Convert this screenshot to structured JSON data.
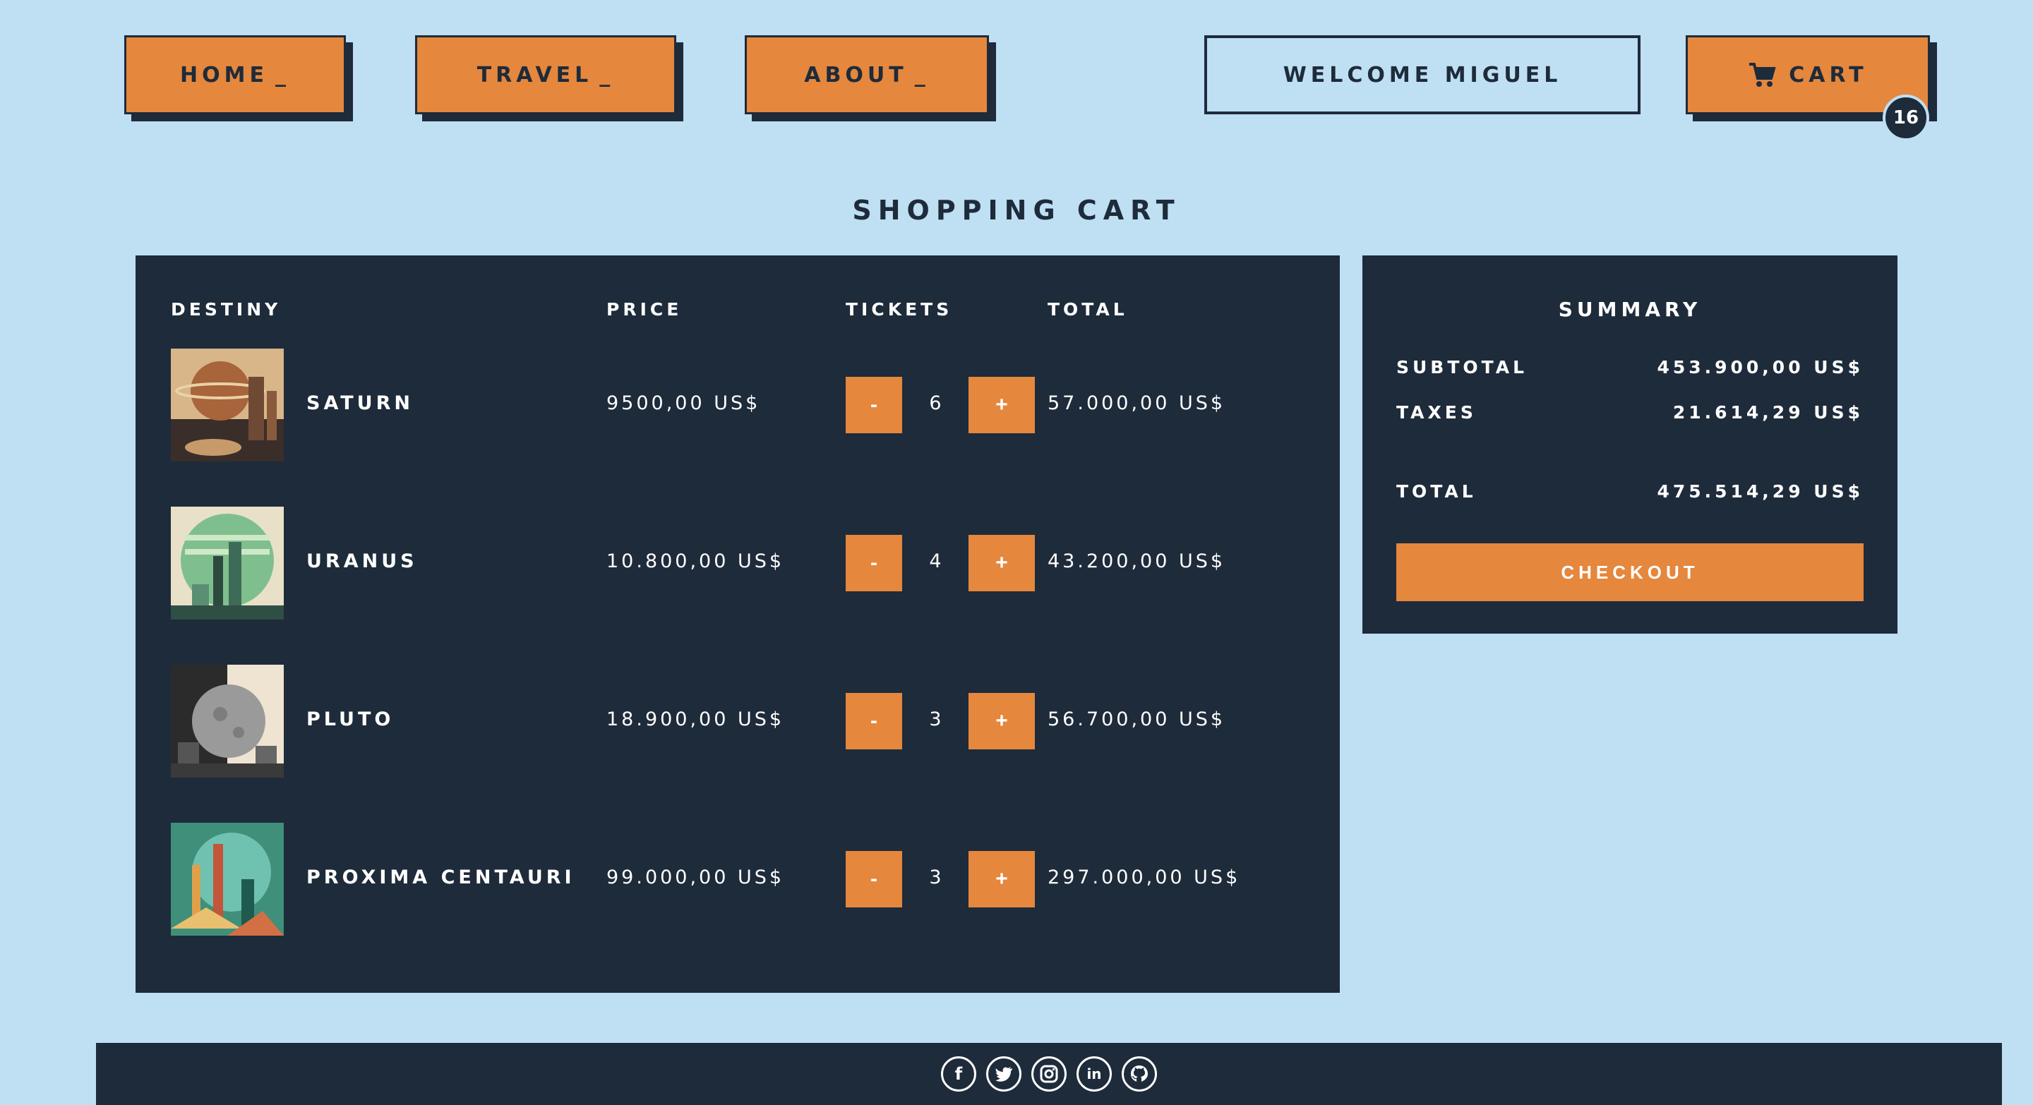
{
  "nav": {
    "home_label": "HOME",
    "travel_label": "TRAVEL",
    "about_label": "ABOUT",
    "caret": "_",
    "welcome_label": "WELCOME MIGUEL",
    "cart_label": "CART",
    "cart_count": "16"
  },
  "page": {
    "title": "SHOPPING CART"
  },
  "cart": {
    "headers": {
      "destiny": "DESTINY",
      "price": "PRICE",
      "tickets": "TICKETS",
      "total": "TOTAL"
    },
    "items": [
      {
        "name": "SATURN",
        "price": "9500,00 US$",
        "qty": "6",
        "total": "57.000,00 US$",
        "minus": "-",
        "plus": "+"
      },
      {
        "name": "URANUS",
        "price": "10.800,00 US$",
        "qty": "4",
        "total": "43.200,00 US$",
        "minus": "-",
        "plus": "+"
      },
      {
        "name": "PLUTO",
        "price": "18.900,00 US$",
        "qty": "3",
        "total": "56.700,00 US$",
        "minus": "-",
        "plus": "+"
      },
      {
        "name": "PROXIMA CENTAURI",
        "price": "99.000,00 US$",
        "qty": "3",
        "total": "297.000,00 US$",
        "minus": "-",
        "plus": "+"
      }
    ]
  },
  "summary": {
    "title": "SUMMARY",
    "subtotal_label": "SUBTOTAL",
    "subtotal_value": "453.900,00 US$",
    "taxes_label": "TAXES",
    "taxes_value": "21.614,29 US$",
    "total_label": "TOTAL",
    "total_value": "475.514,29 US$",
    "checkout_label": "CHECKOUT"
  },
  "footer": {
    "icons": [
      "facebook-icon",
      "twitter-icon",
      "instagram-icon",
      "linkedin-icon",
      "github-icon"
    ],
    "glyphs": {
      "facebook": "f",
      "linkedin": "in"
    }
  },
  "colors": {
    "background": "#bfdff3",
    "panel": "#1e2b3a",
    "accent": "#e5873d"
  }
}
